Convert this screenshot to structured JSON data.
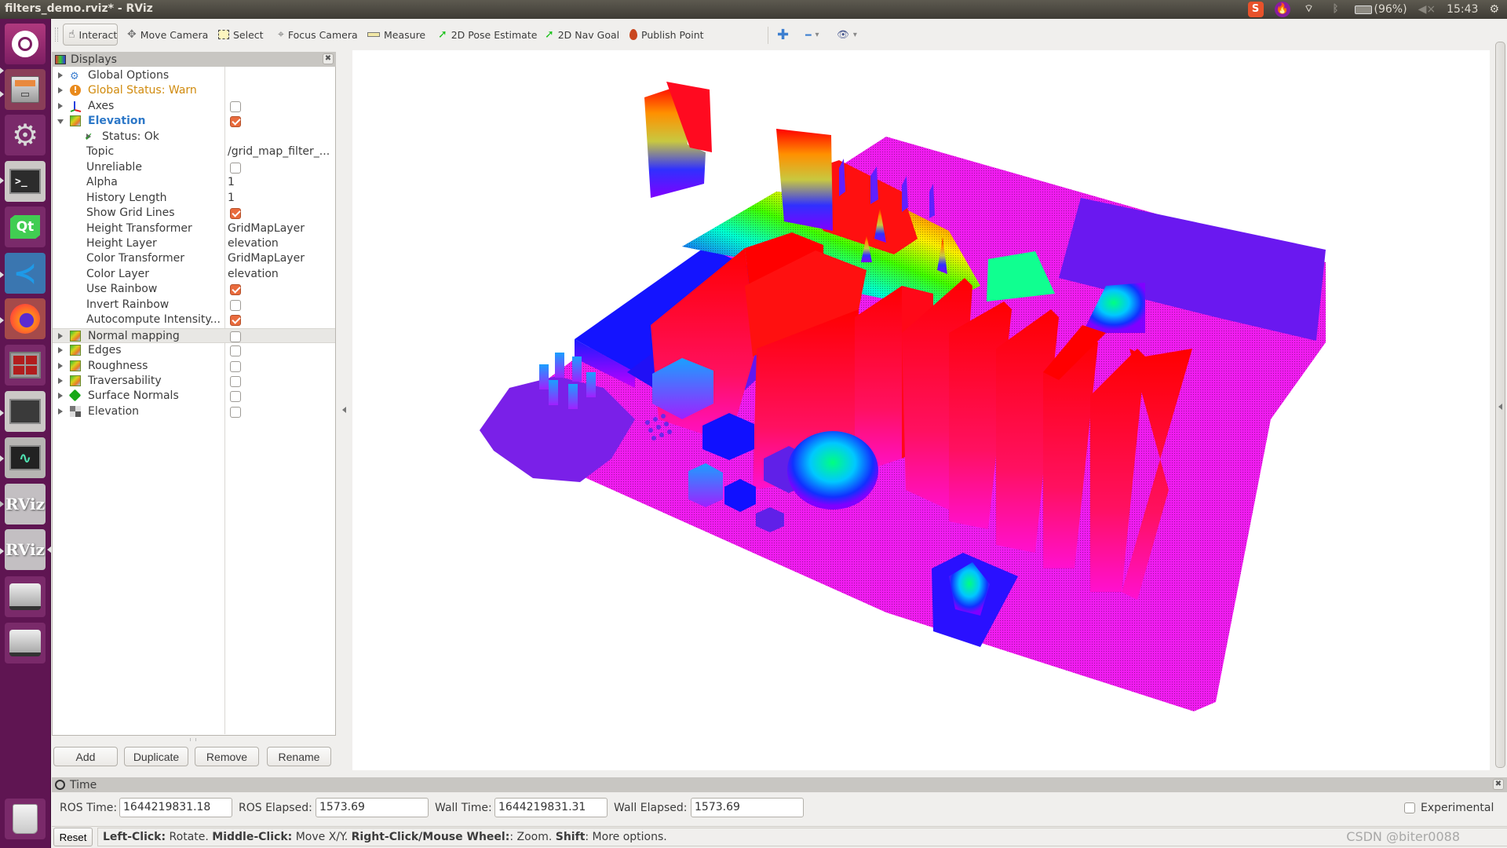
{
  "window": {
    "title": "filters_demo.rviz* - RViz"
  },
  "system_tray": {
    "items": [
      {
        "name": "sogou-input-icon",
        "glyph": "S"
      },
      {
        "name": "flame-app-icon",
        "glyph": "🔥"
      },
      {
        "name": "wifi-icon",
        "glyph": "⌔"
      },
      {
        "name": "bluetooth-icon",
        "glyph": "ᛒ"
      },
      {
        "name": "battery-icon",
        "glyph": "▭"
      }
    ],
    "battery": "(96%)",
    "volume_glyph": "◀×",
    "clock": "15:43",
    "power_glyph": "⚙"
  },
  "launcher": {
    "items": [
      {
        "name": "ubuntu-dash",
        "glyph": "◎"
      },
      {
        "name": "files",
        "glyph": "▤"
      },
      {
        "name": "system-settings",
        "glyph": "⚙"
      },
      {
        "name": "terminal",
        "glyph": ">_"
      },
      {
        "name": "qt-creator",
        "glyph": "Qt"
      },
      {
        "name": "vscode",
        "glyph": "≺"
      },
      {
        "name": "firefox",
        "glyph": "◉"
      },
      {
        "name": "terminator",
        "glyph": "▦"
      },
      {
        "name": "screen",
        "glyph": "▬"
      },
      {
        "name": "system-monitor",
        "glyph": "∿"
      },
      {
        "name": "rviz-1",
        "glyph": "RViz"
      },
      {
        "name": "rviz-2",
        "glyph": "RViz"
      },
      {
        "name": "drive-1",
        "glyph": "⛁"
      },
      {
        "name": "drive-2",
        "glyph": "⛁"
      },
      {
        "name": "trash",
        "glyph": "🗑"
      }
    ]
  },
  "toolbar": {
    "tools": [
      {
        "name": "interact",
        "label": "Interact",
        "glyph": "☝",
        "active": true
      },
      {
        "name": "move-camera",
        "label": "Move Camera",
        "glyph": "✥"
      },
      {
        "name": "select",
        "label": "Select",
        "glyph": "▭"
      },
      {
        "name": "focus-camera",
        "label": "Focus Camera",
        "glyph": "⌖"
      },
      {
        "name": "measure",
        "label": "Measure",
        "glyph": "▭"
      },
      {
        "name": "2d-pose-estimate",
        "label": "2D Pose Estimate",
        "glyph": "➚"
      },
      {
        "name": "2d-nav-goal",
        "label": "2D Nav Goal",
        "glyph": "➚"
      },
      {
        "name": "publish-point",
        "label": "Publish Point",
        "glyph": "📍"
      }
    ],
    "extra": {
      "add_glyph": "✚",
      "remove_glyph": "━",
      "view_glyph": "👁",
      "dropdown_glyph": "▾"
    }
  },
  "displays_panel": {
    "title": "Displays",
    "close_glyph": "✖",
    "rows": [
      {
        "type": "group",
        "label": "Global Options",
        "icon": "gear",
        "expanded": false
      },
      {
        "type": "group",
        "label": "Global Status: Warn",
        "icon": "warn",
        "expanded": false,
        "status": "warn"
      },
      {
        "type": "display",
        "label": "Axes",
        "icon": "axes",
        "expanded": false,
        "checked": false
      },
      {
        "type": "display",
        "label": "Elevation",
        "icon": "gridmap",
        "expanded": true,
        "checked": true,
        "highlight": true
      },
      {
        "type": "status",
        "label": "Status: Ok",
        "icon": "check",
        "expanded": false
      },
      {
        "type": "prop",
        "label": "Topic",
        "value": "/grid_map_filter_..."
      },
      {
        "type": "prop",
        "label": "Unreliable",
        "checked": false
      },
      {
        "type": "prop",
        "label": "Alpha",
        "value": "1"
      },
      {
        "type": "prop",
        "label": "History Length",
        "value": "1"
      },
      {
        "type": "prop",
        "label": "Show Grid Lines",
        "checked": true
      },
      {
        "type": "prop",
        "label": "Height Transformer",
        "value": "GridMapLayer"
      },
      {
        "type": "prop",
        "label": "Height Layer",
        "value": "elevation"
      },
      {
        "type": "prop",
        "label": "Color Transformer",
        "value": "GridMapLayer"
      },
      {
        "type": "prop",
        "label": "Color Layer",
        "value": "elevation"
      },
      {
        "type": "prop",
        "label": "Use Rainbow",
        "checked": true
      },
      {
        "type": "prop",
        "label": "Invert Rainbow",
        "checked": false
      },
      {
        "type": "prop",
        "label": "Autocompute Intensity...",
        "checked": true
      },
      {
        "type": "display",
        "label": "Normal mapping",
        "icon": "gridmap",
        "expanded": false,
        "checked": false,
        "selected": true
      },
      {
        "type": "display",
        "label": "Edges",
        "icon": "gridmap",
        "expanded": false,
        "checked": false
      },
      {
        "type": "display",
        "label": "Roughness",
        "icon": "gridmap",
        "expanded": false,
        "checked": false
      },
      {
        "type": "display",
        "label": "Traversability",
        "icon": "gridmap",
        "expanded": false,
        "checked": false
      },
      {
        "type": "display",
        "label": "Surface Normals",
        "icon": "cube",
        "expanded": false,
        "checked": false
      },
      {
        "type": "display",
        "label": "Elevation",
        "icon": "occupancy",
        "expanded": false,
        "checked": false
      }
    ],
    "buttons": {
      "add": "Add",
      "duplicate": "Duplicate",
      "remove": "Remove",
      "rename": "Rename"
    }
  },
  "viewport": {
    "description": "3D grid map elevation rendered with rainbow colormap",
    "colormap": [
      "#ff00ff",
      "#8000ff",
      "#0000ff",
      "#00ffff",
      "#00ff00",
      "#ffff00",
      "#ff8000",
      "#ff0000"
    ]
  },
  "time_panel": {
    "title": "Time",
    "close_glyph": "✖",
    "ros_time_label": "ROS Time:",
    "ros_time": "1644219831.18",
    "ros_elapsed_label": "ROS Elapsed:",
    "ros_elapsed": "1573.69",
    "wall_time_label": "Wall Time:",
    "wall_time": "1644219831.31",
    "wall_elapsed_label": "Wall Elapsed:",
    "wall_elapsed": "1573.69",
    "experimental_label": "Experimental",
    "experimental_checked": false
  },
  "status_bar": {
    "reset_label": "Reset",
    "hint": [
      {
        "bold": "Left-Click:",
        "text": " Rotate. "
      },
      {
        "bold": "Middle-Click:",
        "text": " Move X/Y. "
      },
      {
        "bold": "Right-Click/Mouse Wheel:",
        "text": ": Zoom. "
      },
      {
        "bold": "Shift",
        "text": ": More options."
      }
    ],
    "watermark": "CSDN @biter0088"
  }
}
